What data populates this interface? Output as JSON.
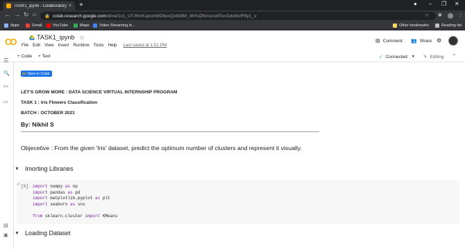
{
  "browser": {
    "tab_title": "TASK1_ipynb - Colaboratory",
    "tab_close": "×",
    "new_tab": "+",
    "url_host": "colab.research.google.com",
    "url_path": "/drive/1x1_UT-RmKupcmWD9eoQxb5lIM_36YuDN#scrollTo=GdsWvfF8y1_o",
    "bookmarks": [
      {
        "label": "Apps",
        "color": "#8ab4f8"
      },
      {
        "label": "Gmail",
        "color": "#ea4335"
      },
      {
        "label": "YouTube",
        "color": "#ff0000"
      },
      {
        "label": "Maps",
        "color": "#34a853"
      },
      {
        "label": "Video Streaming in...",
        "color": "#4285f4"
      }
    ],
    "other_bookmarks": "Other bookmarks",
    "reading_list": "Reading list"
  },
  "colab": {
    "logo": "CO",
    "notebook_title": "TASK1_ipynb",
    "menu": [
      "File",
      "Edit",
      "View",
      "Insert",
      "Runtime",
      "Tools",
      "Help"
    ],
    "last_saved": "Last saved at 1:51 PM",
    "comment": "Comment",
    "share": "Share",
    "add_code": "+ Code",
    "add_text": "+ Text",
    "connected": "Connected",
    "editing": "Editing"
  },
  "notebook": {
    "open_in_colab": "Open in Colab",
    "heading1": "LET'S GROW MORE : DATA SCIENCE VIRTUAL INTERNSHIP PROGRAM",
    "heading2": "TASK 1 : Iris Flowers Classification",
    "heading3": "BATCH : OCTOBER 2021",
    "author": "By: Nikhil S",
    "objective": "Objecetive : From the given 'Iris' dataset, predict the optimum number of clusters and represent it visually.",
    "section1": "Imorting Libraries",
    "section2": "Loading Dataset",
    "exec_count": "[6]",
    "code_lines": [
      {
        "kw": "import",
        "rest": " numpy ",
        "kw2": "as",
        "rest2": " np"
      },
      {
        "kw": "import",
        "rest": " pandas ",
        "kw2": "as",
        "rest2": " pd"
      },
      {
        "kw": "import",
        "rest": " matplotlib.pyplot ",
        "kw2": "as",
        "rest2": " plt"
      },
      {
        "kw": "import",
        "rest": " seaborn ",
        "kw2": "as",
        "rest2": " sns"
      },
      {
        "kw": "",
        "rest": "",
        "kw2": "",
        "rest2": ""
      },
      {
        "kw": "from",
        "rest": " sklearn.cluster ",
        "kw2": "import",
        "rest2": " KMeans"
      }
    ]
  }
}
